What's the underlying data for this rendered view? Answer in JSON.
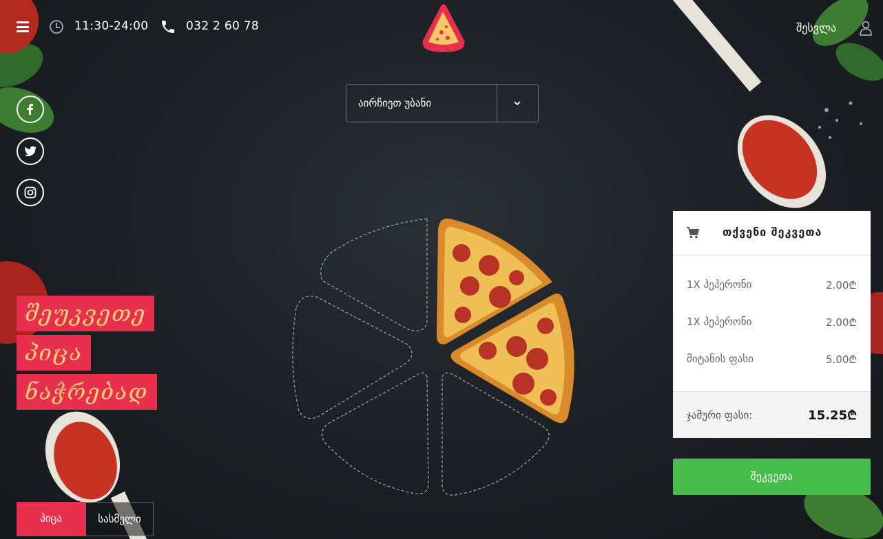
{
  "header": {
    "hours": "11:30-24:00",
    "phone": "032 2 60 78",
    "login_label": "შესვლა"
  },
  "district_select": {
    "selected": "აირჩიეთ უბანი"
  },
  "social": [
    "facebook-icon",
    "twitter-icon",
    "instagram-icon"
  ],
  "hero": {
    "lines": [
      "შეუკვეთე",
      "პიცა",
      "ნაჭრებად"
    ]
  },
  "categories": {
    "active": "პიცა",
    "other": "სასმელი"
  },
  "pizza": {
    "total_slices": 6,
    "selected_slices": 2
  },
  "order": {
    "title": "თქვენი შეკვეთა",
    "items": [
      {
        "name": "1X პეპერონი",
        "price": "2.00₾"
      },
      {
        "name": "1X პეპერონი",
        "price": "2.00₾"
      },
      {
        "name": "მიტანის ფასი",
        "price": "5.00₾"
      }
    ],
    "total_label": "ჯამური ფასი:",
    "total_value": "15.25₾",
    "submit_label": "შეკვეთა"
  },
  "colors": {
    "accent_red": "#e8304e",
    "hero_text": "#f7d277",
    "submit_green": "#47bd4c",
    "background": "#1e2226"
  }
}
